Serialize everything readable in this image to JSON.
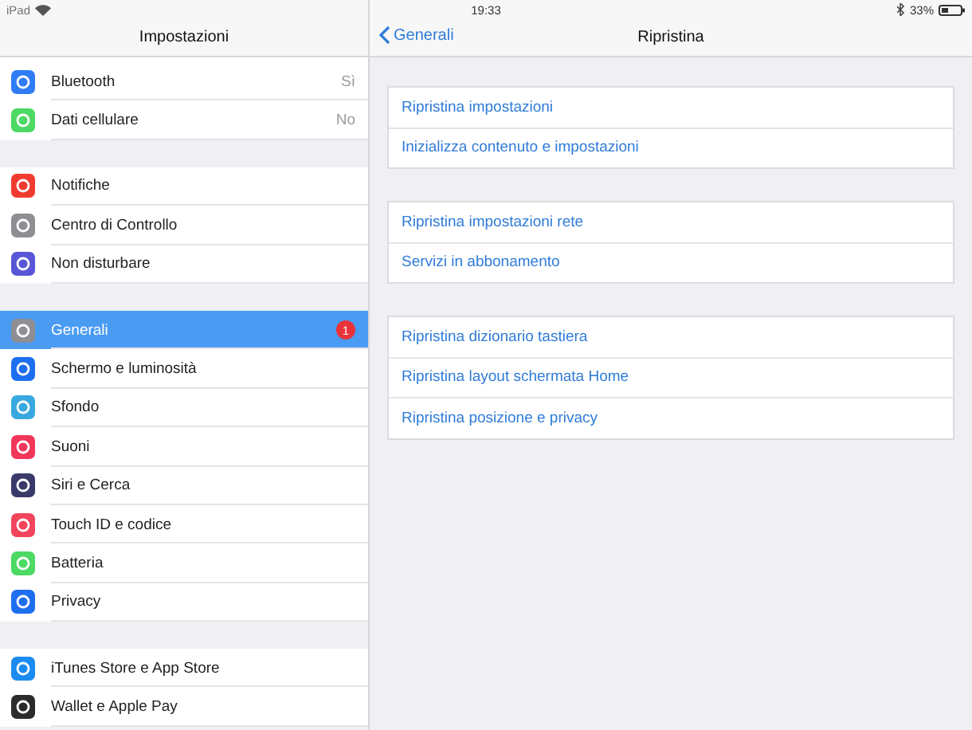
{
  "status_bar": {
    "device": "iPad",
    "time": "19:33",
    "battery": "33%"
  },
  "sidebar": {
    "title": "Impostazioni",
    "groups": [
      [
        {
          "label": "Bluetooth",
          "value": "Sì",
          "selected": false
        },
        {
          "label": "Dati cellulare",
          "value": "No",
          "selected": false
        }
      ],
      [
        {
          "label": "Notifiche",
          "selected": false
        },
        {
          "label": "Centro di Controllo",
          "selected": false
        },
        {
          "label": "Non disturbare",
          "selected": false
        }
      ],
      [
        {
          "label": "Generali",
          "badge": "1",
          "selected": true
        },
        {
          "label": "Schermo e luminosità",
          "selected": false
        },
        {
          "label": "Sfondo",
          "selected": false
        },
        {
          "label": "Suoni",
          "selected": false
        },
        {
          "label": "Siri e Cerca",
          "selected": false
        },
        {
          "label": "Touch ID e codice",
          "selected": false
        },
        {
          "label": "Batteria",
          "selected": false
        },
        {
          "label": "Privacy",
          "selected": false
        }
      ],
      [
        {
          "label": "iTunes Store e App Store",
          "selected": false
        },
        {
          "label": "Wallet e Apple Pay",
          "selected": false
        }
      ]
    ]
  },
  "detail": {
    "back": "Generali",
    "title": "Ripristina",
    "groups": [
      [
        "Ripristina impostazioni",
        "Inizializza contenuto e impostazioni"
      ],
      [
        "Ripristina impostazioni rete",
        "Servizi in abbonamento"
      ],
      [
        "Ripristina dizionario tastiera",
        "Ripristina layout schermata Home",
        "Ripristina posizione e privacy"
      ]
    ]
  }
}
